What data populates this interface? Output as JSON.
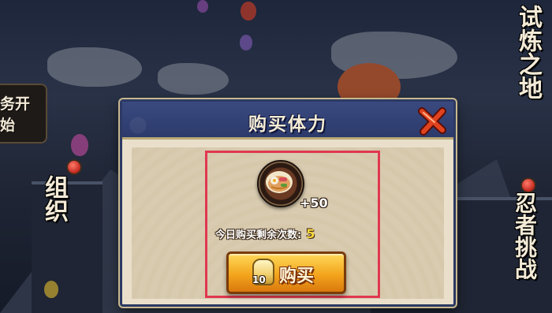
{
  "screen": {
    "left_menu": {
      "start_tag_label": "务开始",
      "organization_label": "组织"
    },
    "right_menu": {
      "trial_ground_label": "试炼之地",
      "ninja_challenge_label": "忍者挑战"
    }
  },
  "dialog": {
    "title": "购买体力",
    "item": {
      "icon": "ramen-bowl-icon",
      "amount": "+50"
    },
    "remaining_label": "今日购买剩余次数:",
    "remaining_value": "5",
    "buy_button": {
      "cost": "10",
      "cost_icon": "coin-stack-icon",
      "label": "购买"
    },
    "close_icon": "close-x-icon"
  },
  "colors": {
    "header_blue": "#2c3a6b",
    "highlight_red": "#e0374f",
    "button_orange": "#f3a51c",
    "value_yellow": "#ffd83a"
  }
}
